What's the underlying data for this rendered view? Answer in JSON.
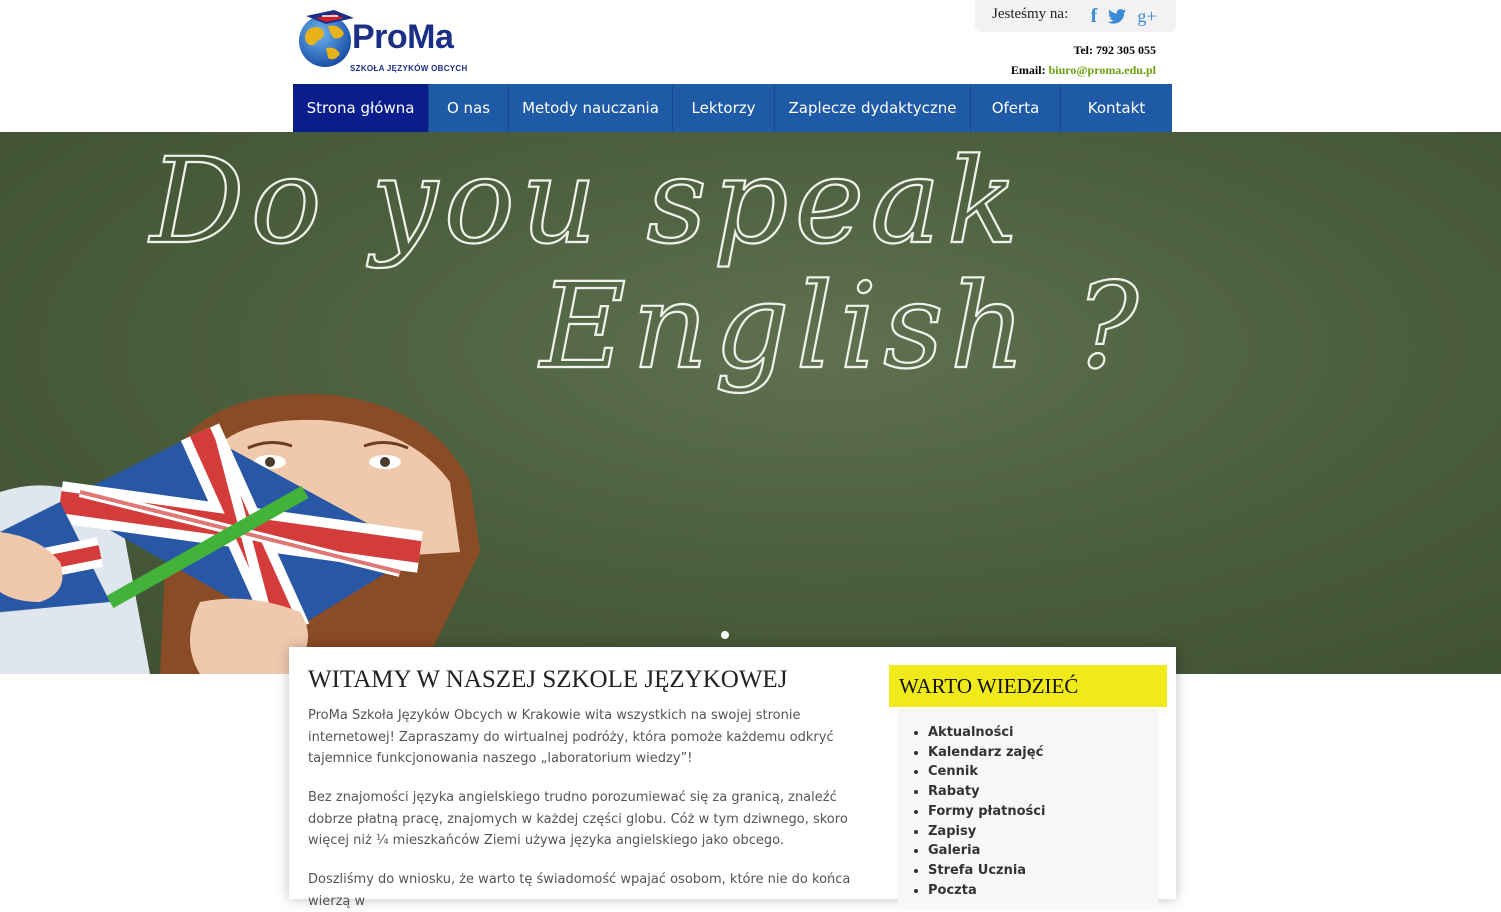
{
  "header": {
    "logo_name": "ProMa",
    "logo_tagline": "SZKOŁA JĘZYKÓW OBCYCH",
    "social_label": "Jesteśmy na:",
    "social_icons": [
      "facebook-icon",
      "twitter-icon",
      "google-plus-icon"
    ],
    "social_glyphs": {
      "facebook": "f",
      "google_plus": "g+"
    },
    "tel_label": "Tel:",
    "tel": "792 305 055",
    "email_label": "Email:",
    "email": "biuro@proma.edu.pl"
  },
  "nav": {
    "items": [
      {
        "label": "Strona główna",
        "active": true
      },
      {
        "label": "O nas",
        "active": false
      },
      {
        "label": "Metody nauczania",
        "active": false
      },
      {
        "label": "Lektorzy",
        "active": false
      },
      {
        "label": "Zaplecze dydaktyczne",
        "active": false
      },
      {
        "label": "Oferta",
        "active": false
      },
      {
        "label": "Kontakt",
        "active": false
      }
    ]
  },
  "hero": {
    "chalk_line1": "Do you speak",
    "chalk_line2": "English ?"
  },
  "main": {
    "title": "WITAMY W NASZEJ SZKOLE JĘZYKOWEJ",
    "paragraphs": [
      "ProMa Szkoła Języków Obcych w Krakowie wita wszystkich na swojej stronie internetowej! Zapraszamy do wirtualnej podróży, która pomoże każdemu odkryć tajemnice funkcjonowania naszego „laboratorium wiedzy”!",
      "Bez znajomości języka angielskiego trudno porozumiewać się za granicą, znaleźć dobrze płatną pracę, znajomych w każdej części globu. Cóż w tym dziwnego, skoro więcej niż ¼ mieszkańców Ziemi używa języka angielskiego jako obcego.",
      "Doszliśmy do wniosku, że warto tę świadomość wpajać osobom, które nie do końca wierzą w"
    ]
  },
  "sidebar": {
    "title": "WARTO WIEDZIEĆ",
    "items": [
      "Aktualności",
      "Kalendarz zajęć",
      "Cennik",
      "Rabaty",
      "Formy płatności",
      "Zapisy",
      "Galeria",
      "Strefa Ucznia",
      "Poczta"
    ]
  },
  "colors": {
    "nav_bg": "#1e5aa6",
    "nav_active": "#0a1d8c",
    "sidebar_title_bg": "#f1ea1b",
    "email_link": "#6aa10e",
    "social_icon": "#3b8ad6"
  }
}
